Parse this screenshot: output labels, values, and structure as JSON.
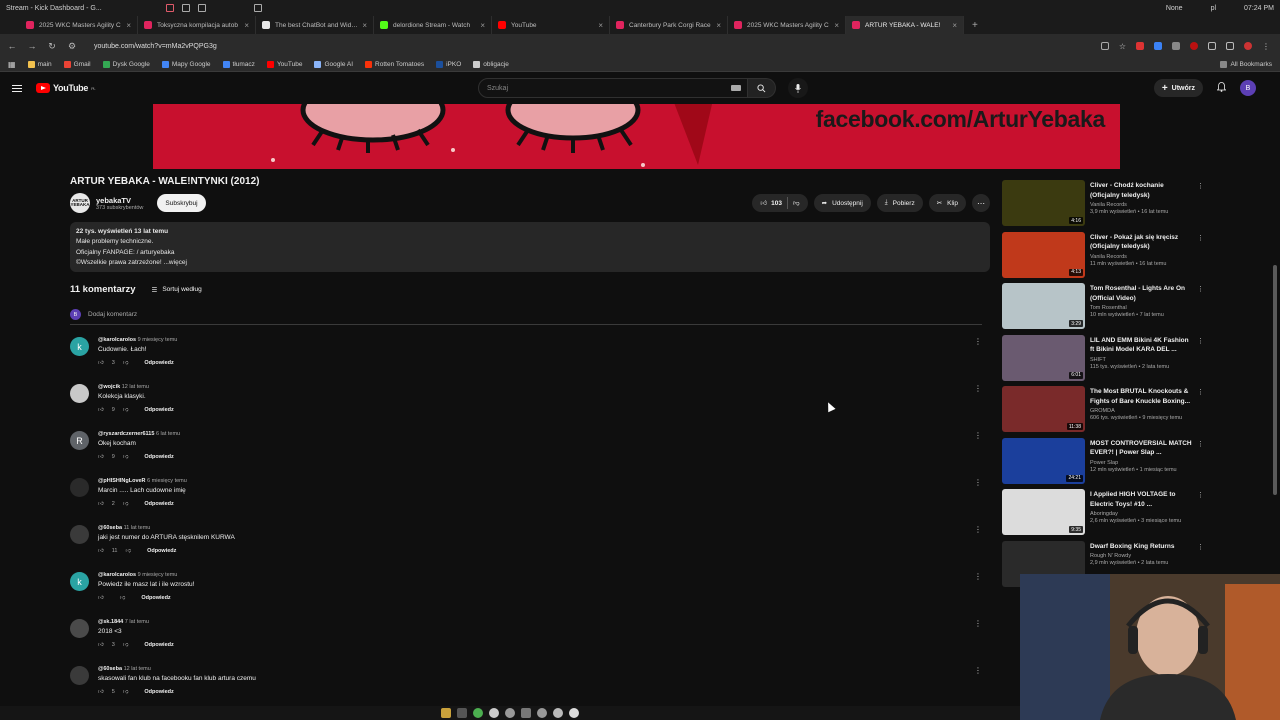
{
  "os_bar": {
    "title": "Stream - Kick Dashboard - G...",
    "tray_none": "None",
    "tray_user": "pl",
    "clock": "07:24 PM"
  },
  "tabs": [
    {
      "label": "2025 WKC Masters Agility C",
      "color": "#e0245e"
    },
    {
      "label": "Toksyczna kompilacja autob",
      "color": "#e0245e"
    },
    {
      "label": "The best ChatBot and Widge",
      "color": "#e8e8e8"
    },
    {
      "label": "delordione Stream - Watch",
      "color": "#53fc18"
    },
    {
      "label": "YouTube",
      "color": "#ff0000"
    },
    {
      "label": "Canterbury Park Corgi Race",
      "color": "#e0245e"
    },
    {
      "label": "2025 WKC Masters Agility C",
      "color": "#e0245e"
    },
    {
      "label": "ARTUR YEBAKA - WALE!",
      "color": "#e0245e"
    }
  ],
  "url": "youtube.com/watch?v=mMa2vPQPG3g",
  "bookmarks": [
    {
      "label": "main",
      "color": "#f2c14e"
    },
    {
      "label": "Gmail",
      "color": "#ea4335"
    },
    {
      "label": "Dysk Google",
      "color": "#34a853"
    },
    {
      "label": "Mapy Google",
      "color": "#4285f4"
    },
    {
      "label": "tłumacz",
      "color": "#4285f4"
    },
    {
      "label": "YouTube",
      "color": "#ff0000"
    },
    {
      "label": "Google AI",
      "color": "#8ab4f8"
    },
    {
      "label": "Rotten Tomatoes",
      "color": "#fa320a"
    },
    {
      "label": "iPKO",
      "color": "#1b4f9c"
    },
    {
      "label": "obligacje",
      "color": "#cccccc"
    }
  ],
  "bookmarks_all": "All Bookmarks",
  "yt": {
    "logo": "YouTube",
    "logo_region": "PL",
    "search_placeholder": "Szukaj",
    "create_label": "Utwórz",
    "avatar_letter": "B"
  },
  "video": {
    "overlay_text": "facebook.com/ArturYebaka",
    "title": "ARTUR YEBAKA - WALE!NTYNKI (2012)",
    "channel_avatar_text": "ARTUR YEBAKA",
    "channel_name": "yebakaTV",
    "subscribers": "373 subskrybentów",
    "subscribe_label": "Subskrybuj",
    "likes": "103",
    "share_label": "Udostępnij",
    "download_label": "Pobierz",
    "clip_label": "Klip"
  },
  "description": {
    "stats": "22 tys. wyświetleń  13 lat temu",
    "line1": "Małe problemy techniczne.",
    "line2": "Oficjalny FANPAGE:  / arturyebaka",
    "line3": "©Wszelkie prawa zatrzeżone! ...więcej"
  },
  "comments_header": {
    "count": "11 komentarzy",
    "sort_label": "Sortuj według",
    "add_placeholder": "Dodaj komentarz",
    "add_avatar": "B"
  },
  "comments": [
    {
      "user": "@karolcarolos",
      "time": "9 miesięcy temu",
      "text": "Cudownie. Łach!",
      "likes": "3",
      "reply": "Odpowiedz",
      "avatar": "k",
      "avatar_color": "#2aa3a3"
    },
    {
      "user": "@wojcik",
      "time": "12 lat temu",
      "text": "Kolekcja klasyki.",
      "likes": "9",
      "reply": "Odpowiedz",
      "avatar": "",
      "avatar_color": "#c9c9c9"
    },
    {
      "user": "@ryszardczerner6115",
      "time": "6 lat temu",
      "text": "Okej  kocham",
      "likes": "9",
      "reply": "Odpowiedz",
      "avatar": "R",
      "avatar_color": "#5f6368"
    },
    {
      "user": "@pHISHINgLoveR",
      "time": "6 miesięcy temu",
      "text": "Marcin ..... Lach cudowne imię",
      "likes": "2",
      "reply": "Odpowiedz",
      "avatar": "",
      "avatar_color": "#2a2a2a"
    },
    {
      "user": "@60seba",
      "time": "11 lat temu",
      "text": "jaki jest numer do ARTURA stęsknilem  KURWA",
      "likes": "11",
      "reply": "Odpowiedz",
      "avatar": "",
      "avatar_color": "#3a3a3a"
    },
    {
      "user": "@karolcarolos",
      "time": "9 miesięcy temu",
      "text": "Powiedz ile masz lat i ile wzrostu!",
      "likes": "",
      "reply": "Odpowiedz",
      "avatar": "k",
      "avatar_color": "#2aa3a3"
    },
    {
      "user": "@sk.1844",
      "time": "7 lat temu",
      "text": "2018 <3",
      "likes": "3",
      "reply": "Odpowiedz",
      "avatar": "",
      "avatar_color": "#4a4a4a"
    },
    {
      "user": "@60seba",
      "time": "12 lat temu",
      "text": "skasowali fan klub na facebooku fan klub artura  czemu",
      "likes": "5",
      "reply": "Odpowiedz",
      "avatar": "",
      "avatar_color": "#3a3a3a"
    }
  ],
  "recommendations": [
    {
      "title": "Cliver - Chodź kochanie (Oficjalny teledysk)",
      "channel": "Vanila Records",
      "meta": "3,9 mln wyświetleń • 16 lat temu",
      "duration": "4:16",
      "thumb_color": "#3b3a10"
    },
    {
      "title": "Cliver - Pokaż jak się kręcisz (Oficjalny teledysk)",
      "channel": "Vanila Records",
      "meta": "11 mln wyświetleń • 16 lat temu",
      "duration": "4:13",
      "thumb_color": "#c0391b"
    },
    {
      "title": "Tom Rosenthal - Lights Are On (Official Video)",
      "channel": "Tom Rosenthal",
      "meta": "10 mln wyświetleń • 7 lat temu",
      "duration": "3:29",
      "thumb_color": "#b7c4c8"
    },
    {
      "title": "LIL AND EMM Bikini 4K Fashion ft Bikini Model KARA DEL ...",
      "channel": "SHIFT",
      "meta": "115 tys. wyświetleń • 2 lata temu",
      "duration": "6:01",
      "thumb_color": "#6a5a70"
    },
    {
      "title": "The Most BRUTAL Knockouts & Fights of Bare Knuckle Boxing...",
      "channel": "GROMDA",
      "meta": "606 tys. wyświetleń • 9 miesięcy temu",
      "duration": "11:38",
      "thumb_color": "#7a2a2a"
    },
    {
      "title": "MOST CONTROVERSIAL MATCH EVER?! | Power Slap ...",
      "channel": "Power Slap",
      "meta": "12 mln wyświetleń • 1 miesiąc temu",
      "duration": "24:21",
      "thumb_color": "#1b3f9c"
    },
    {
      "title": "I Applied HIGH VOLTAGE to Electric Toys! #10 ...",
      "channel": "Aboringday",
      "meta": "2,6 mln wyświetleń • 3 miesiące temu",
      "duration": "9:35",
      "thumb_color": "#dcdcdc"
    },
    {
      "title": "Dwarf Boxing King Returns",
      "channel": "Rough N' Rowdy",
      "meta": "2,9 mln wyświetleń • 2 lata temu",
      "duration": "",
      "thumb_color": "#2a2a2a"
    }
  ]
}
